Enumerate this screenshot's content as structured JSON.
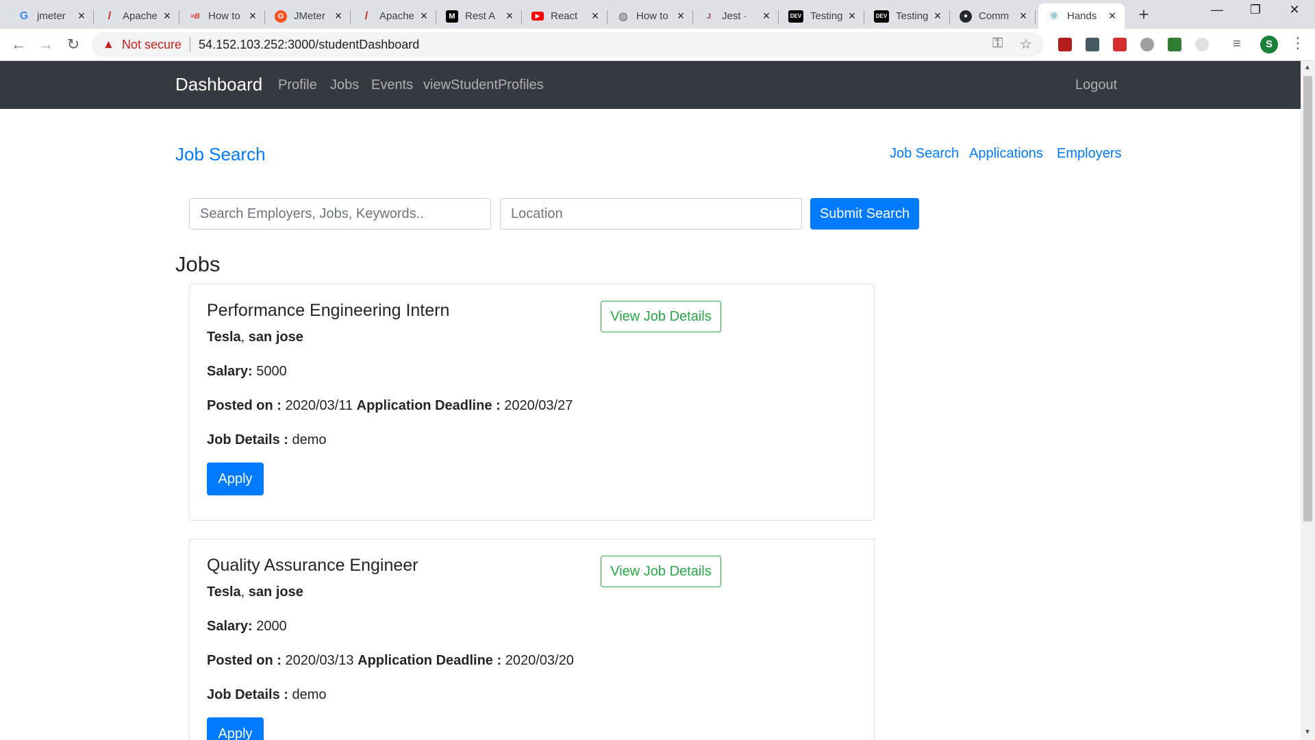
{
  "browser": {
    "tabs": [
      {
        "title": "jmeter",
        "favicon": "google-icon",
        "active": false
      },
      {
        "title": "Apache",
        "favicon": "apache-feather-icon",
        "active": false
      },
      {
        "title": "How to",
        "favicon": "guru99-icon",
        "active": false
      },
      {
        "title": "JMeter",
        "favicon": "orange-g-icon",
        "active": false
      },
      {
        "title": "Apache",
        "favicon": "apache-feather-icon",
        "active": false
      },
      {
        "title": "Rest A",
        "favicon": "medium-icon",
        "active": false
      },
      {
        "title": "React",
        "favicon": "youtube-icon",
        "active": false
      },
      {
        "title": "How to",
        "favicon": "globe-icon",
        "active": false
      },
      {
        "title": "Jest ·",
        "favicon": "jest-icon",
        "active": false
      },
      {
        "title": "Testing",
        "favicon": "dev-icon",
        "active": false
      },
      {
        "title": "Testing",
        "favicon": "dev-icon",
        "active": false
      },
      {
        "title": "Comm",
        "favicon": "github-icon",
        "active": false
      },
      {
        "title": "Hands",
        "favicon": "react-icon",
        "active": true
      }
    ],
    "security_label": "Not secure",
    "url": "54.152.103.252:3000/studentDashboard",
    "profile_initial": "S"
  },
  "navbar": {
    "brand": "Dashboard",
    "links": [
      "Profile",
      "Jobs",
      "Events",
      "viewStudentProfiles"
    ],
    "logout": "Logout"
  },
  "page": {
    "title": "Job Search",
    "subnav": [
      "Job Search",
      "Applications",
      "Employers"
    ],
    "search": {
      "keyword_placeholder": "Search Employers, Jobs, Keywords..",
      "location_placeholder": "Location",
      "submit_label": "Submit Search"
    },
    "jobs_heading": "Jobs"
  },
  "labels": {
    "salary": "Salary:",
    "posted_on": "Posted on :",
    "deadline": "Application Deadline :",
    "details": "Job Details :",
    "view_details": "View Job Details",
    "apply": "Apply"
  },
  "jobs": [
    {
      "title": "Performance Engineering Intern",
      "company": "Tesla",
      "location": "san jose",
      "salary": "5000",
      "posted_on": "2020/03/11",
      "deadline": "2020/03/27",
      "details": "demo"
    },
    {
      "title": "Quality Assurance Engineer",
      "company": "Tesla",
      "location": "san jose",
      "salary": "2000",
      "posted_on": "2020/03/13",
      "deadline": "2020/03/20",
      "details": "demo"
    }
  ]
}
